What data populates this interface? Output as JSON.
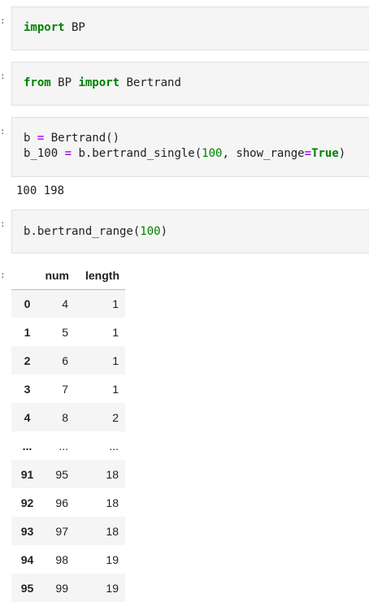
{
  "cells": [
    {
      "prompt": ":",
      "code": [
        [
          {
            "t": "import",
            "c": "kw"
          },
          {
            "t": " BP",
            "c": "fn"
          }
        ]
      ]
    },
    {
      "prompt": ":",
      "code": [
        [
          {
            "t": "from",
            "c": "kw"
          },
          {
            "t": " BP ",
            "c": "fn"
          },
          {
            "t": "import",
            "c": "kw"
          },
          {
            "t": " Bertrand",
            "c": "fn"
          }
        ]
      ]
    },
    {
      "prompt": ":",
      "code": [
        [
          {
            "t": "b ",
            "c": "fn"
          },
          {
            "t": "=",
            "c": "op"
          },
          {
            "t": " Bertrand()",
            "c": "fn"
          }
        ],
        [
          {
            "t": "b_100 ",
            "c": "fn"
          },
          {
            "t": "=",
            "c": "op"
          },
          {
            "t": " b.bertrand_single(",
            "c": "fn"
          },
          {
            "t": "100",
            "c": "num"
          },
          {
            "t": ", show_range",
            "c": "fn"
          },
          {
            "t": "=",
            "c": "op"
          },
          {
            "t": "True",
            "c": "kw"
          },
          {
            "t": ")",
            "c": "fn"
          }
        ]
      ]
    },
    {
      "prompt": ":",
      "code": [
        [
          {
            "t": "b.bertrand_range(",
            "c": "fn"
          },
          {
            "t": "100",
            "c": "num"
          },
          {
            "t": ")",
            "c": "fn"
          }
        ]
      ]
    }
  ],
  "stdout": "100 198",
  "output_prompt": ":",
  "dataframe": {
    "columns": [
      "num",
      "length"
    ],
    "rows": [
      {
        "index": "0",
        "num": "4",
        "length": "1"
      },
      {
        "index": "1",
        "num": "5",
        "length": "1"
      },
      {
        "index": "2",
        "num": "6",
        "length": "1"
      },
      {
        "index": "3",
        "num": "7",
        "length": "1"
      },
      {
        "index": "4",
        "num": "8",
        "length": "2"
      },
      {
        "index": "...",
        "num": "...",
        "length": "..."
      },
      {
        "index": "91",
        "num": "95",
        "length": "18"
      },
      {
        "index": "92",
        "num": "96",
        "length": "18"
      },
      {
        "index": "93",
        "num": "97",
        "length": "18"
      },
      {
        "index": "94",
        "num": "98",
        "length": "19"
      },
      {
        "index": "95",
        "num": "99",
        "length": "19"
      }
    ]
  },
  "colors": {
    "keyword": "#008000",
    "operator": "#aa22ff",
    "number": "#008000",
    "cell_bg": "#f5f5f5"
  }
}
